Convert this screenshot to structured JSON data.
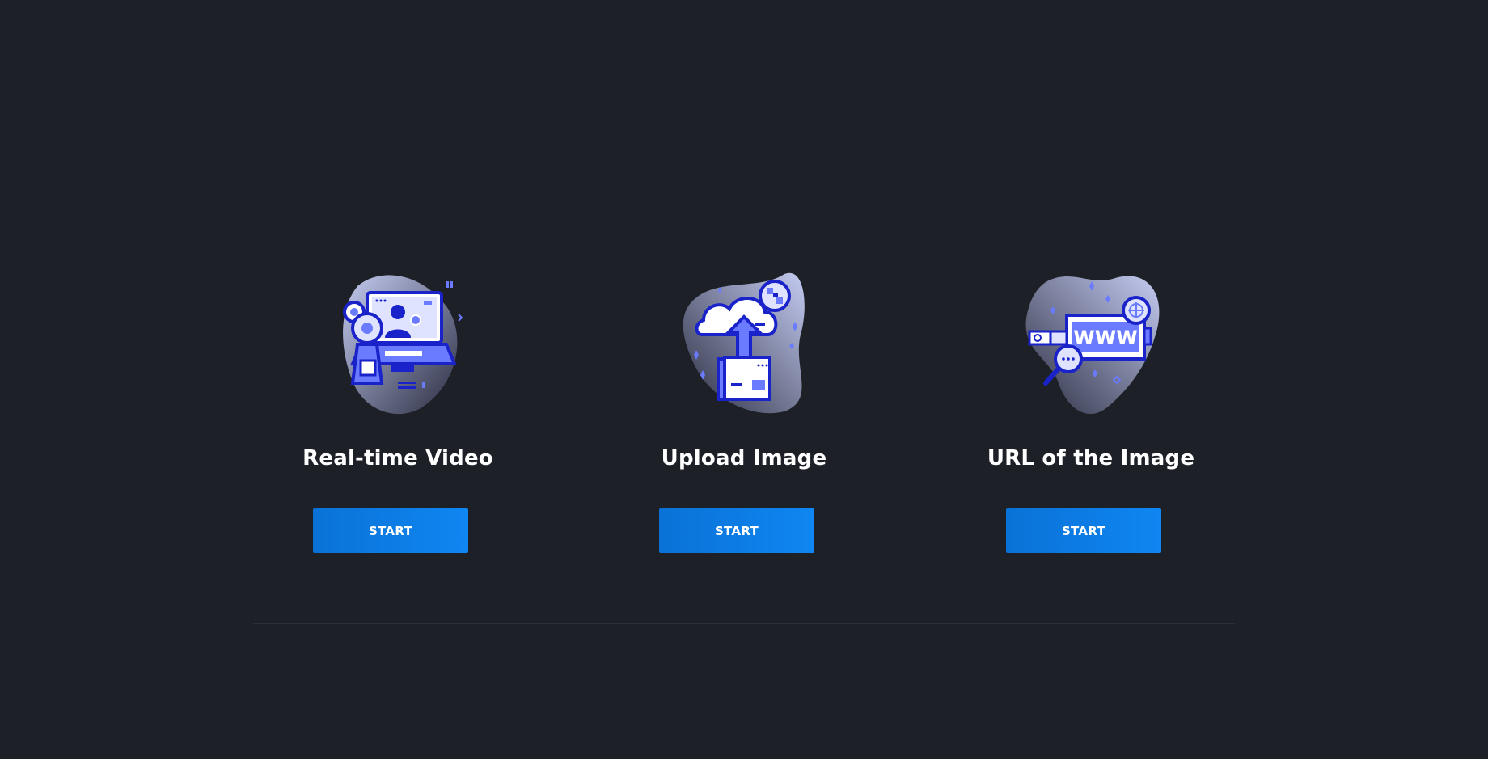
{
  "options": [
    {
      "title": "Real-time Video",
      "button_label": "START",
      "icon": "video-call-icon"
    },
    {
      "title": "Upload Image",
      "button_label": "START",
      "icon": "cloud-upload-icon"
    },
    {
      "title": "URL of the Image",
      "button_label": "START",
      "icon": "web-url-icon"
    }
  ],
  "colors": {
    "background": "#1e2028",
    "button": "#0f86f2",
    "illustration_primary": "#2a35e6",
    "illustration_light": "#8f9cff",
    "divider": "#2c2f38"
  }
}
